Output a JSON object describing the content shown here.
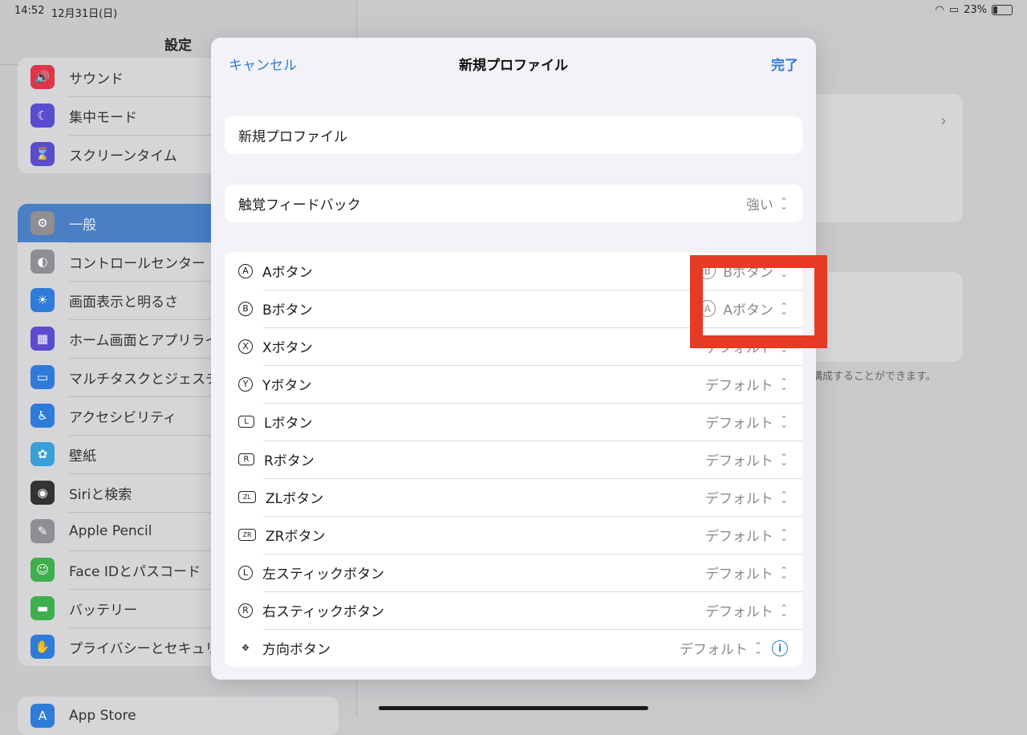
{
  "status": {
    "time": "14:52",
    "date": "12月31日(日)",
    "battery": "23%"
  },
  "sidebar": {
    "title": "設定",
    "group1": [
      {
        "label": "サウンド",
        "color": "#e0344a",
        "icon": "🔊"
      },
      {
        "label": "集中モード",
        "color": "#5a4ccf",
        "icon": "☾"
      },
      {
        "label": "スクリーンタイム",
        "color": "#5a4ccf",
        "icon": "⌛"
      }
    ],
    "group2": [
      {
        "label": "一般",
        "color": "#8e8e93",
        "icon": "⚙"
      },
      {
        "label": "コントロールセンター",
        "color": "#8e8e93",
        "icon": "◐"
      },
      {
        "label": "画面表示と明るさ",
        "color": "#2f7bd9",
        "icon": "☀"
      },
      {
        "label": "ホーム画面とアプリライ",
        "color": "#5a4ccf",
        "icon": "▦"
      },
      {
        "label": "マルチタスクとジェスチ",
        "color": "#2f7bd9",
        "icon": "▭"
      },
      {
        "label": "アクセシビリティ",
        "color": "#2f7bd9",
        "icon": "♿"
      },
      {
        "label": "壁紙",
        "color": "#3aa0d8",
        "icon": "✿"
      },
      {
        "label": "Siriと検索",
        "color": "#333333",
        "icon": "◉"
      },
      {
        "label": "Apple Pencil",
        "color": "#8e8e93",
        "icon": "✎"
      },
      {
        "label": "Face IDとパスコード",
        "color": "#3fae4c",
        "icon": "☺"
      },
      {
        "label": "バッテリー",
        "color": "#3fae4c",
        "icon": "▬"
      },
      {
        "label": "プライバシーとセキュリ",
        "color": "#2f7bd9",
        "icon": "✋"
      }
    ],
    "group3": [
      {
        "label": "App Store",
        "color": "#2f7bd9",
        "icon": "A"
      }
    ]
  },
  "detail": {
    "note": "構成することができます。"
  },
  "modal": {
    "cancel": "キャンセル",
    "title": "新規プロファイル",
    "done": "完了",
    "name_value": "新規プロファイル",
    "haptic": {
      "label": "触覚フィードバック",
      "value": "強い"
    },
    "buttons": [
      {
        "glyph": "A",
        "shape": "circle",
        "label": "Aボタン",
        "value_glyph": "B",
        "value": "Bボタン"
      },
      {
        "glyph": "B",
        "shape": "circle",
        "label": "Bボタン",
        "value_glyph": "A",
        "value": "Aボタン"
      },
      {
        "glyph": "X",
        "shape": "circle",
        "label": "Xボタン",
        "value_glyph": "",
        "value": "デフォルト"
      },
      {
        "glyph": "Y",
        "shape": "circle",
        "label": "Yボタン",
        "value_glyph": "",
        "value": "デフォルト"
      },
      {
        "glyph": "L",
        "shape": "rect",
        "label": "Lボタン",
        "value_glyph": "",
        "value": "デフォルト"
      },
      {
        "glyph": "R",
        "shape": "rect",
        "label": "Rボタン",
        "value_glyph": "",
        "value": "デフォルト"
      },
      {
        "glyph": "ZL",
        "shape": "rect-small",
        "label": "ZLボタン",
        "value_glyph": "",
        "value": "デフォルト"
      },
      {
        "glyph": "ZR",
        "shape": "rect-small",
        "label": "ZRボタン",
        "value_glyph": "",
        "value": "デフォルト"
      },
      {
        "glyph": "L",
        "shape": "stick",
        "label": "左スティックボタン",
        "value_glyph": "",
        "value": "デフォルト"
      },
      {
        "glyph": "R",
        "shape": "stick",
        "label": "右スティックボタン",
        "value_glyph": "",
        "value": "デフォルト"
      },
      {
        "glyph": "✥",
        "shape": "dpad",
        "label": "方向ボタン",
        "value_glyph": "",
        "value": "デフォルト",
        "info": "i"
      }
    ]
  },
  "annotation": {
    "color": "#e53a23"
  }
}
